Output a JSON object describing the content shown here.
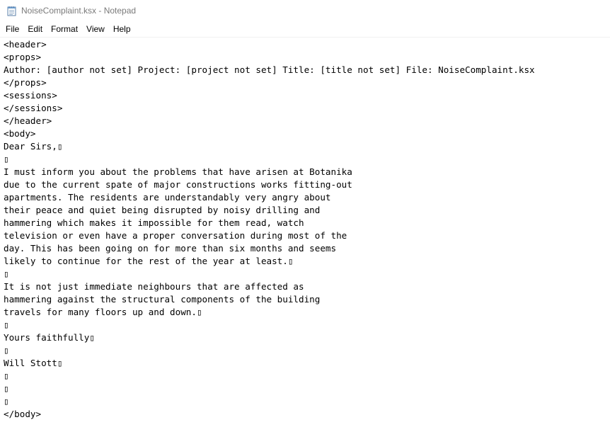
{
  "window": {
    "title": "NoiseComplaint.ksx - Notepad",
    "app_icon": "notepad-icon"
  },
  "menu": {
    "items": [
      {
        "label": "File"
      },
      {
        "label": "Edit"
      },
      {
        "label": "Format"
      },
      {
        "label": "View"
      },
      {
        "label": "Help"
      }
    ]
  },
  "editor": {
    "content": "<header>\n<props>\nAuthor: [author not set] Project: [project not set] Title: [title not set] File: NoiseComplaint.ksx\n</props>\n<sessions>\n</sessions>\n</header>\n<body>\nDear Sirs,▯\n▯\nI must inform you about the problems that have arisen at Botanika\ndue to the current spate of major constructions works fitting-out\napartments. The residents are understandably very angry about\ntheir peace and quiet being disrupted by noisy drilling and\nhammering which makes it impossible for them read, watch\ntelevision or even have a proper conversation during most of the\nday. This has been going on for more than six months and seems\nlikely to continue for the rest of the year at least.▯\n▯\nIt is not just immediate neighbours that are affected as\nhammering against the structural components of the building\ntravels for many floors up and down.▯\n▯\nYours faithfully▯\n▯\nWill Stott▯\n▯\n▯\n▯\n</body>"
  }
}
